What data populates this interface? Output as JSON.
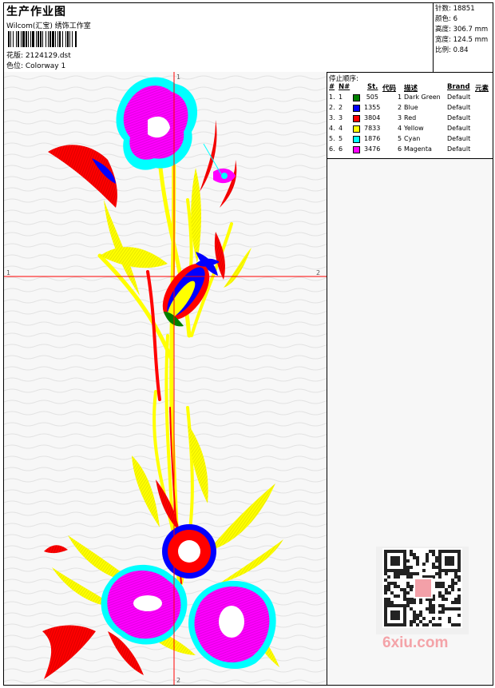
{
  "header": {
    "title": "生产作业图",
    "company": "Wilcom(汇宝) 绣饰工作室",
    "design_line": "花版: 2124129.dst",
    "color_line": "色位: Colorway 1"
  },
  "stats": {
    "stitches": "针数: 18851",
    "colors": "颜色: 6",
    "height": "高度: 306.7 mm",
    "width": "宽度: 124.5 mm",
    "scale": "比例: 0.84"
  },
  "stop_table": {
    "title": "停止顺序:",
    "headers": {
      "num": "#",
      "n": "N#",
      "st": "St.",
      "code": "代码",
      "desc": "描述",
      "brand": "Brand",
      "elem": "元素"
    },
    "rows": [
      {
        "num": "1.",
        "n": "1",
        "color": "#008000",
        "st": "505",
        "code": "1",
        "desc": "Dark Green",
        "brand": "Default"
      },
      {
        "num": "2.",
        "n": "2",
        "color": "#0000ff",
        "st": "1355",
        "code": "2",
        "desc": "Blue",
        "brand": "Default"
      },
      {
        "num": "3.",
        "n": "3",
        "color": "#ff0000",
        "st": "3804",
        "code": "3",
        "desc": "Red",
        "brand": "Default"
      },
      {
        "num": "4.",
        "n": "4",
        "color": "#ffff00",
        "st": "7833",
        "code": "4",
        "desc": "Yellow",
        "brand": "Default"
      },
      {
        "num": "5.",
        "n": "5",
        "color": "#00ffff",
        "st": "1876",
        "code": "5",
        "desc": "Cyan",
        "brand": "Default"
      },
      {
        "num": "6.",
        "n": "6",
        "color": "#ff00ff",
        "st": "3476",
        "code": "6",
        "desc": "Magenta",
        "brand": "Default"
      }
    ]
  },
  "canvas": {
    "axis_top": "1",
    "axis_left": "1",
    "axis_right": "2",
    "axis_bottom": "2"
  },
  "watermark": "6xiu.com",
  "icons": {
    "barcode": "barcode-icon",
    "qr": "qr-code-icon"
  }
}
